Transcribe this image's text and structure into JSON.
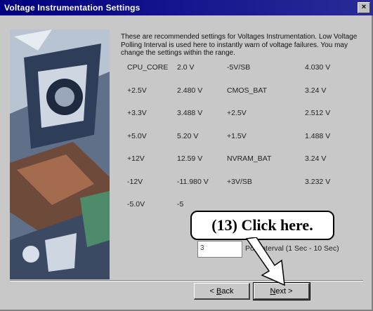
{
  "window": {
    "title": "Voltage Instrumentation Settings",
    "close_glyph": "×"
  },
  "intro_text": "These are recommended settings for Voltages Instrumentation. Low Voltage Polling Interval is used here to instantly warn of voltage failures. You may change the settings within the range.",
  "voltages": [
    {
      "label": "CPU_CORE",
      "value": "2.0 V",
      "label2": "-5V/SB",
      "value2": "4.030 V"
    },
    {
      "label": "+2.5V",
      "value": "2.480 V",
      "label2": "CMOS_BAT",
      "value2": "3.24 V"
    },
    {
      "label": "+3.3V",
      "value": "3.488 V",
      "label2": "+2.5V",
      "value2": "2.512 V"
    },
    {
      "label": "+5.0V",
      "value": "5.20 V",
      "label2": "+1.5V",
      "value2": "1.488 V"
    },
    {
      "label": "+12V",
      "value": "12.59 V",
      "label2": "NVRAM_BAT",
      "value2": "3.24 V"
    },
    {
      "label": "-12V",
      "value": "-11.980 V",
      "label2": "+3V/SB",
      "value2": "3.232 V"
    },
    {
      "label": "-5.0V",
      "value": "-5",
      "label2": "",
      "value2": ""
    }
  ],
  "polling": {
    "label": "Poll Interval (1 Sec - 10 Sec)",
    "value": "3"
  },
  "buttons": {
    "back_prefix": "< ",
    "back_underlined": "B",
    "back_rest": "ack",
    "next_underlined": "N",
    "next_rest": "ext >"
  },
  "callout": {
    "text": "(13)  Click here."
  },
  "colors": {
    "title_bar": "#000080",
    "dialog_bg": "#c8c8c8"
  }
}
